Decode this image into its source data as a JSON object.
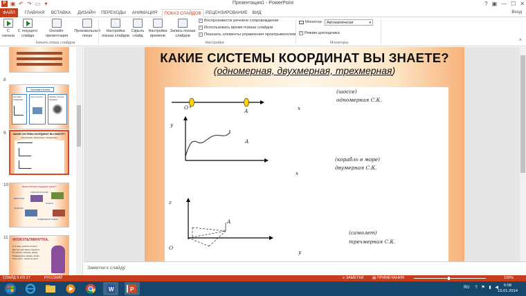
{
  "window": {
    "title": "Презентация1 - PowerPoint",
    "signin": "Вход"
  },
  "tabs": [
    "ФАЙЛ",
    "ГЛАВНАЯ",
    "ВСТАВКА",
    "ДИЗАЙН",
    "ПЕРЕХОДЫ",
    "АНИМАЦИЯ",
    "ПОКАЗ СЛАЙДОВ",
    "РЕЦЕНЗИРОВАНИЕ",
    "ВИД"
  ],
  "ribbon": {
    "buttons": {
      "from_start": "С начала",
      "from_current": "С текущего слайда",
      "online": "Онлайн-презентация",
      "custom": "Произвольный показ",
      "setup": "Настройка показа слайдов",
      "hide": "Скрыть слайд",
      "rehearse": "Настройка времени",
      "record": "Запись показа слайдов"
    },
    "checks": {
      "play_narration": "Воспроизвести речевое сопровождение",
      "use_timings": "Использовать время показа слайдов",
      "show_controls": "Показать элементы управления проигрывателем",
      "presenter_view": "Режим докладчика"
    },
    "monitor_label": "Монитор:",
    "monitor_value": "Автоматически",
    "groups": {
      "start": "Начать показ слайдов",
      "setup": "Настройка",
      "monitors": "Мониторы"
    }
  },
  "thumbnails": {
    "numbers": [
      "8",
      "9",
      "10",
      "11"
    ],
    "t8_title": "Система отсчета",
    "t8_cells": [
      "система координат",
      "тело отсчета",
      "прибор отсчета времени"
    ],
    "t9_title": "КАКИЕ СИСТЕМЫ КООРДИНАТ ВЫ ЗНАЕТЕ?",
    "t9_sub": "(одномерная, двухмерная, трехмерная)",
    "t10_title": "Какая система координат нужна?",
    "t10_words": [
      "ТРАКТОР В ПОЛЕ",
      "ВЕРТОЛЕТ",
      "РАКЕТА",
      "ЛЫЖНИК",
      "ПОДВОДНАЯ ЛОДКА"
    ],
    "t11_title": "ФИЗКУЛЬТМИНУТКА.",
    "t11_lines": [
      "А теперь, ребята, встали!",
      "Быстро руки вверх подняли,",
      "В стороны, вперед, назад,",
      "Повернулись вправо, влево,",
      "Тихо сели – вновь за дело."
    ]
  },
  "slide": {
    "title": "КАКИЕ СИСТЕМЫ КООРДИНАТ ВЫ ЗНАЕТЕ?",
    "subtitle_open": "(",
    "subtitle": "одномерная, двухмерная, трехмерная",
    "subtitle_close": ")",
    "figure": {
      "label_road": "(шоссе)",
      "label_1d": "одномерная С.К.",
      "label_ship": "(корабль в море)",
      "label_2d": "двумерная С.К.",
      "label_plane": "(самолет)",
      "label_3d": "трехмерная С.К.",
      "o1": "О",
      "a1": "А",
      "x1": "х",
      "y2": "у",
      "a2": "А",
      "x2": "х",
      "z3": "z",
      "a3": "А",
      "o3": "О",
      "y3": "у"
    }
  },
  "notes_placeholder": "Заметки к слайду",
  "status": {
    "slide_of": "СЛАЙД 9 ИЗ 27",
    "lang": "РУССКИЙ",
    "notes": "ЗАМЕТКИ",
    "comments": "ПРИМЕЧАНИЯ",
    "zoom": "100%"
  },
  "taskbar": {
    "lang": "RU",
    "time": "5:08",
    "date": "15.01.2014"
  }
}
